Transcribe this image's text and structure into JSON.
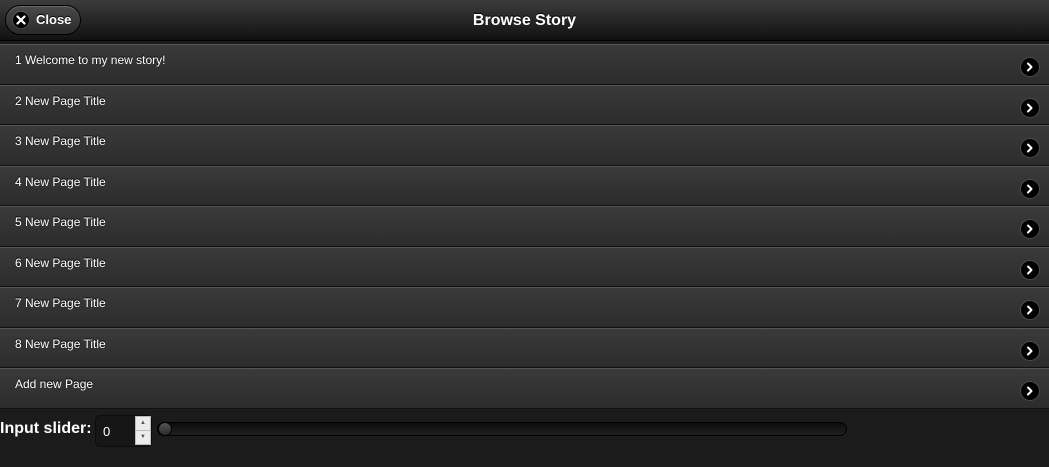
{
  "header": {
    "title": "Browse Story",
    "close_label": "Close"
  },
  "list": {
    "items": [
      {
        "label": "1 Welcome to my new story!"
      },
      {
        "label": "2 New Page Title"
      },
      {
        "label": "3 New Page Title"
      },
      {
        "label": "4 New Page Title"
      },
      {
        "label": "5 New Page Title"
      },
      {
        "label": "6 New Page Title"
      },
      {
        "label": "7 New Page Title"
      },
      {
        "label": "8 New Page Title"
      },
      {
        "label": "Add new Page"
      }
    ]
  },
  "slider": {
    "label": "Input slider:",
    "value": "0",
    "level": 0
  },
  "icons": {
    "close": "close-icon",
    "item_arrow": "chevron-right-icon"
  },
  "colors": {
    "background": "#1b1b1b",
    "bar": "#2c2c2c",
    "text": "#ffffff"
  }
}
